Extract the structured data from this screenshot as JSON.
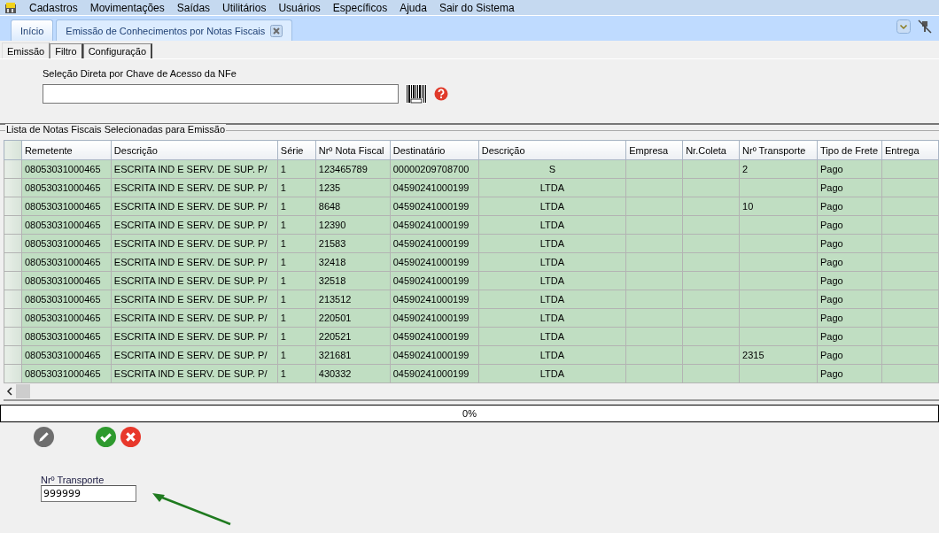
{
  "menu": [
    "Cadastros",
    "Movimentações",
    "Saídas",
    "Utilitários",
    "Usuários",
    "Específicos",
    "Ajuda",
    "Sair do Sistema"
  ],
  "tabs": [
    {
      "label": "Início",
      "selected": false,
      "closable": false
    },
    {
      "label": "Emissão de Conhecimentos por Notas Fiscais",
      "selected": true,
      "closable": true
    }
  ],
  "subtabs": [
    {
      "label": "Emissão",
      "selected": true
    },
    {
      "label": "Filtro",
      "selected": false
    },
    {
      "label": "Configuração",
      "selected": false
    }
  ],
  "access_key": {
    "label": "Seleção Direta por Chave de Acesso da NFe"
  },
  "list": {
    "title": "Lista de Notas Fiscais Selecionadas para Emissão",
    "columns": [
      "Remetente",
      "Descrição",
      "Série",
      "Nrº Nota Fiscal",
      "Destinatário",
      "Descrição",
      "Empresa",
      "Nr.Coleta",
      "Nrº Transporte",
      "Tipo de Frete",
      "Entrega"
    ],
    "rows": [
      {
        "remetente": "08053031000465",
        "descricao": "ESCRITA IND E SERV. DE SUP. P/",
        "serie": "1",
        "nota_fiscal": "123465789",
        "destinatario": "00000209708700",
        "descricao_2": "S",
        "transporte": "2",
        "tipo_frete": "Pago"
      },
      {
        "remetente": "08053031000465",
        "descricao": "ESCRITA IND E SERV. DE SUP. P/",
        "serie": "1",
        "nota_fiscal": "1235",
        "destinatario": "04590241000199",
        "descricao_2": "LTDA",
        "tipo_frete": "Pago"
      },
      {
        "remetente": "08053031000465",
        "descricao": "ESCRITA IND E SERV. DE SUP. P/",
        "serie": "1",
        "nota_fiscal": "8648",
        "destinatario": "04590241000199",
        "descricao_2": "LTDA",
        "transporte": "10",
        "tipo_frete": "Pago"
      },
      {
        "remetente": "08053031000465",
        "descricao": "ESCRITA IND E SERV. DE SUP. P/",
        "serie": "1",
        "nota_fiscal": "12390",
        "destinatario": "04590241000199",
        "descricao_2": "LTDA",
        "tipo_frete": "Pago"
      },
      {
        "remetente": "08053031000465",
        "descricao": "ESCRITA IND E SERV. DE SUP. P/",
        "serie": "1",
        "nota_fiscal": "21583",
        "destinatario": "04590241000199",
        "descricao_2": "LTDA",
        "tipo_frete": "Pago"
      },
      {
        "remetente": "08053031000465",
        "descricao": "ESCRITA IND E SERV. DE SUP. P/",
        "serie": "1",
        "nota_fiscal": "32418",
        "destinatario": "04590241000199",
        "descricao_2": "LTDA",
        "tipo_frete": "Pago"
      },
      {
        "remetente": "08053031000465",
        "descricao": "ESCRITA IND E SERV. DE SUP. P/",
        "serie": "1",
        "nota_fiscal": "32518",
        "destinatario": "04590241000199",
        "descricao_2": "LTDA",
        "tipo_frete": "Pago"
      },
      {
        "remetente": "08053031000465",
        "descricao": "ESCRITA IND E SERV. DE SUP. P/",
        "serie": "1",
        "nota_fiscal": "213512",
        "destinatario": "04590241000199",
        "descricao_2": "LTDA",
        "tipo_frete": "Pago"
      },
      {
        "remetente": "08053031000465",
        "descricao": "ESCRITA IND E SERV. DE SUP. P/",
        "serie": "1",
        "nota_fiscal": "220501",
        "destinatario": "04590241000199",
        "descricao_2": "LTDA",
        "tipo_frete": "Pago"
      },
      {
        "remetente": "08053031000465",
        "descricao": "ESCRITA IND E SERV. DE SUP. P/",
        "serie": "1",
        "nota_fiscal": "220521",
        "destinatario": "04590241000199",
        "descricao_2": "LTDA",
        "tipo_frete": "Pago"
      },
      {
        "remetente": "08053031000465",
        "descricao": "ESCRITA IND E SERV. DE SUP. P/",
        "serie": "1",
        "nota_fiscal": "321681",
        "destinatario": "04590241000199",
        "descricao_2": "LTDA",
        "transporte": "2315",
        "tipo_frete": "Pago"
      },
      {
        "remetente": "08053031000465",
        "descricao": "ESCRITA IND E SERV. DE SUP. P/",
        "serie": "1",
        "nota_fiscal": "430332",
        "destinatario": "04590241000199",
        "descricao_2": "LTDA",
        "tipo_frete": "Pago"
      }
    ]
  },
  "progress": {
    "level": 0,
    "reading": "0%"
  },
  "transport_field": {
    "label": "Nrº Transporte",
    "value": "999999"
  }
}
